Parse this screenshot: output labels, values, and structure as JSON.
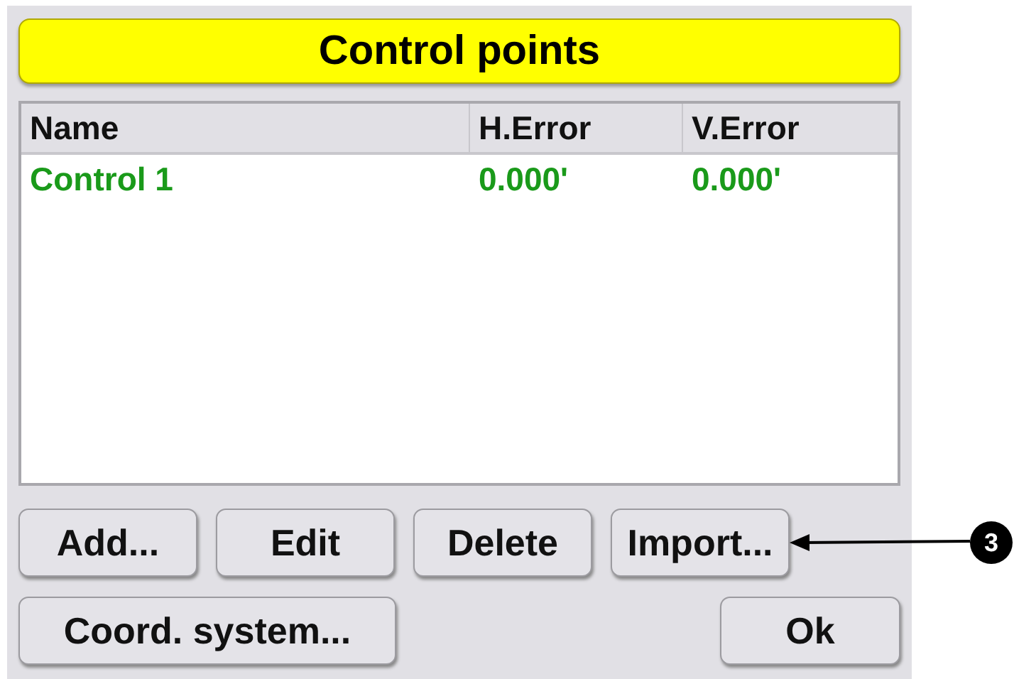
{
  "dialog": {
    "title": "Control points"
  },
  "table": {
    "columns": [
      "Name",
      "H.Error",
      "V.Error"
    ],
    "rows": [
      [
        "Control 1",
        "0.000'",
        "0.000'"
      ]
    ]
  },
  "action_buttons": [
    {
      "label": "Add..."
    },
    {
      "label": "Edit"
    },
    {
      "label": "Delete"
    },
    {
      "label": "Import...",
      "callout": "3"
    }
  ],
  "footer_buttons": [
    {
      "label": "Coord. system..."
    },
    {
      "label": "Ok"
    }
  ]
}
